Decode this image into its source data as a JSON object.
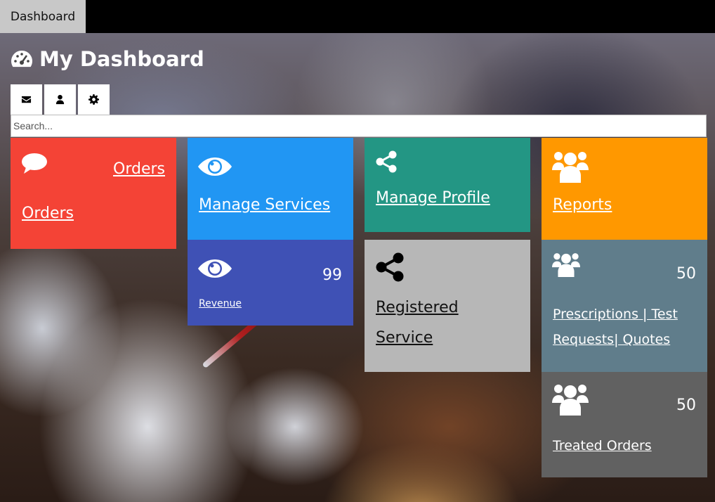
{
  "topbar": {
    "tab_label": "Dashboard"
  },
  "header": {
    "title": "My Dashboard",
    "title_icon": "tachometer-icon"
  },
  "toolbar": {
    "buttons": [
      {
        "icon": "envelope-icon"
      },
      {
        "icon": "user-icon"
      },
      {
        "icon": "gear-icon"
      }
    ]
  },
  "search": {
    "placeholder": "Search...",
    "value": ""
  },
  "tiles": {
    "orders": {
      "label_top": "Orders",
      "label_bottom": "Orders",
      "icon": "comment-icon",
      "color": "#f44336"
    },
    "manage_services": {
      "label": "Manage Services",
      "icon": "eye-icon",
      "color": "#2196f3"
    },
    "revenue": {
      "label": "Revenue",
      "count": "99",
      "icon": "eye-icon",
      "color": "#3f51b5"
    },
    "manage_profile": {
      "label": "Manage Profile",
      "icon": "share-icon",
      "color": "#239684"
    },
    "registered_service": {
      "label_line1": "Registered",
      "label_line2": "Service",
      "icon": "share-icon",
      "color": "#b7b7b7"
    },
    "reports": {
      "label": "Reports",
      "icon": "users-icon",
      "color": "#ff9800"
    },
    "prescriptions": {
      "label_line1": "Prescriptions | Test",
      "label_line2": "Requests| Quotes",
      "count": "50",
      "icon": "users-icon",
      "color": "#607d8b"
    },
    "treated_orders": {
      "label": "Treated Orders",
      "count": "50",
      "icon": "users-icon",
      "color": "#616161"
    }
  }
}
